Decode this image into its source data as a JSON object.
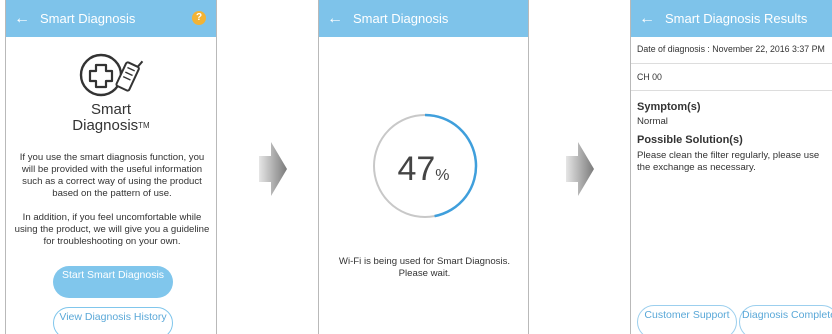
{
  "screen1": {
    "back_icon": "arrow-left-icon",
    "title": "Smart Diagnosis",
    "help_icon": "help-icon",
    "help_glyph": "?",
    "logo_icon": "smart-diagnosis-logo-icon",
    "logo_line1": "Smart",
    "logo_line2": "Diagnosis",
    "logo_tm": "TM",
    "paragraph1": "If you use the smart diagnosis function, you will be provided with the useful information such as a correct way of using the product based on the pattern of use.",
    "paragraph2": "In addition, if you feel uncomfortable while using the product, we will give you a guideline for troubleshooting on your own.",
    "start_button": "Start Smart Diagnosis",
    "history_button": "View Diagnosis History"
  },
  "screen2": {
    "back_icon": "arrow-left-icon",
    "title": "Smart Diagnosis",
    "progress_value": 47,
    "progress_sign": "%",
    "wait_text": "Wi-Fi is being used for Smart Diagnosis. Please wait."
  },
  "screen3": {
    "back_icon": "arrow-left-icon",
    "title": "Smart Diagnosis Results",
    "date_line": "Date of diagnosis : November 22, 2016 3:37 PM",
    "code": "CH 00",
    "symptom_heading": "Symptom(s)",
    "symptom_value": "Normal",
    "solution_heading": "Possible Solution(s)",
    "solution_text": "Please clean the filter regularly, please use the exchange as necessary.",
    "support_button": "Customer Support",
    "complete_button": "Diagnosis Complete"
  },
  "colors": {
    "appbar": "#7ec3ea",
    "accent": "#3f9fdc",
    "help": "#f2b335",
    "arrow": "#8a8a8a"
  }
}
